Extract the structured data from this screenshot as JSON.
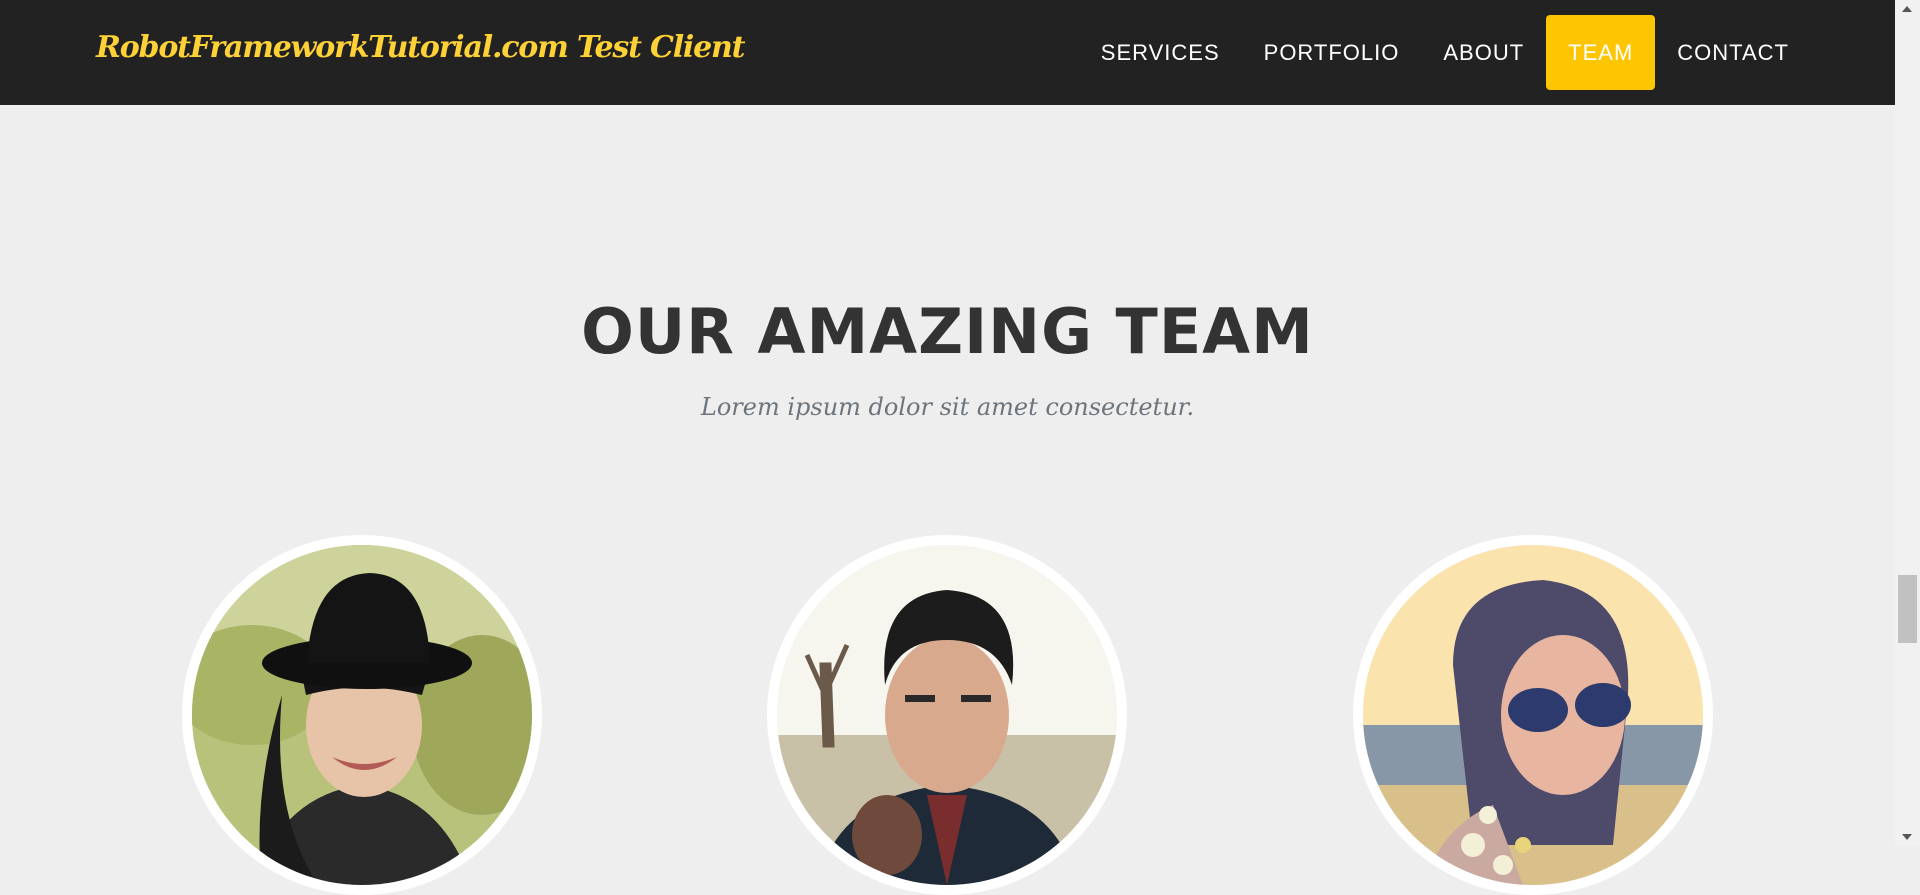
{
  "navbar": {
    "brand": "RobotFrameworkTutorial.com Test Client",
    "items": [
      {
        "label": "Services"
      },
      {
        "label": "Portfolio"
      },
      {
        "label": "About"
      },
      {
        "label": "Team",
        "active": true
      },
      {
        "label": "Contact"
      }
    ]
  },
  "team": {
    "heading": "OUR AMAZING TEAM",
    "subheading": "Lorem ipsum dolor sit amet consectetur."
  },
  "colors": {
    "navbar_bg": "#222222",
    "brand": "#fed136",
    "active_nav": "#fec503",
    "page_bg": "#eeeeee",
    "heading": "#333333"
  }
}
